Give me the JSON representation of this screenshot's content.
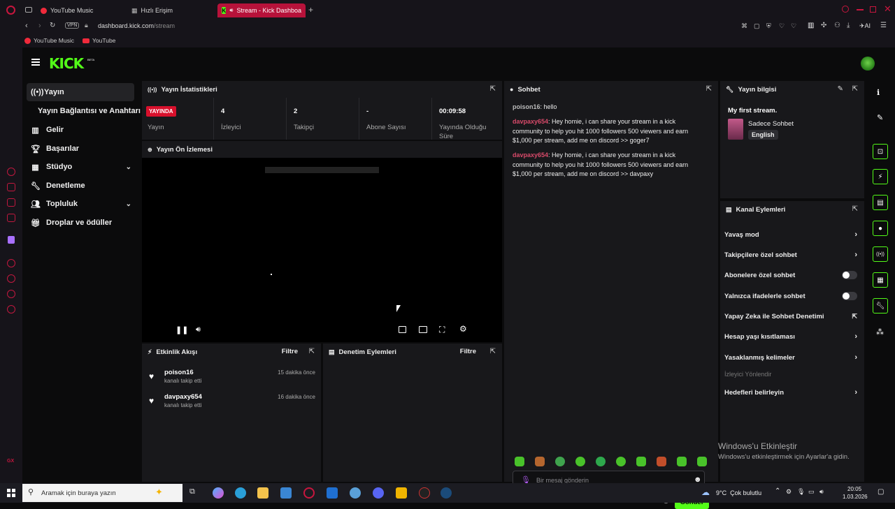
{
  "browser": {
    "tabs": [
      {
        "label": "YouTube Music"
      },
      {
        "label": "Hızlı Erişim"
      },
      {
        "label": "Stream - Kick Dashboa"
      }
    ],
    "url_host": "dashboard.kick.com",
    "url_path": "/stream",
    "vpn": "VPN",
    "bookmarks": [
      "YouTube Music",
      "YouTube"
    ],
    "ai_label": "AI"
  },
  "brand": {
    "logo": "KICK",
    "beta": "BETA",
    "accent": "#53fc18"
  },
  "sidebar": {
    "items": [
      {
        "label": "Yayın",
        "icon": "broadcast-icon"
      },
      {
        "label": "Yayın Bağlantısı ve Anahtarı",
        "icon": ""
      },
      {
        "label": "Gelir",
        "icon": "chart-icon"
      },
      {
        "label": "Başarılar",
        "icon": "trophy-icon"
      },
      {
        "label": "Stüdyo",
        "icon": "studio-icon"
      },
      {
        "label": "Denetleme",
        "icon": "wrench-icon"
      },
      {
        "label": "Topluluk",
        "icon": "people-icon"
      },
      {
        "label": "Droplar ve ödüller",
        "icon": "gift-icon"
      }
    ]
  },
  "stats": {
    "title": "Yayın İstatistikleri",
    "live_badge": "YAYINDA",
    "live_label": "Yayın",
    "viewers_value": "4",
    "viewers_label": "İzleyici",
    "followers_value": "2",
    "followers_label": "Takipçi",
    "subs_value": "-",
    "subs_label": "Abone Sayısı",
    "uptime_value": "00:09:58",
    "uptime_label_1": "Yayında Olduğu",
    "uptime_label_2": "Süre"
  },
  "preview": {
    "title": "Yayın Ön İzlemesi"
  },
  "activity": {
    "title": "Etkinlik Akışı",
    "filter": "Filtre",
    "items": [
      {
        "name": "poison16",
        "sub": "kanalı takip etti",
        "time": "15 dakika önce"
      },
      {
        "name": "davpaxy654",
        "sub": "kanalı takip etti",
        "time": "16 dakika önce"
      }
    ]
  },
  "moderation": {
    "title": "Denetim Eylemleri",
    "filter": "Filtre"
  },
  "chat": {
    "title": "Sohbet",
    "messages": [
      {
        "user": "poison16",
        "text": ": hello"
      },
      {
        "user": "davpaxy654",
        "text": ": Hey homie, i can share your stream in a kick community to help you hit 1000 followers 500 viewers and earn $1,000 per stream, add me on discord >> goger7"
      },
      {
        "user": "davpaxy654",
        "text": ": Hey homie, i can share your stream in a kick community to help you hit 1000 followers 500 viewers and earn $1,000 per stream, add me on discord >> davpaxy"
      }
    ],
    "placeholder": "Bir mesaj gönderin",
    "send": "Gönder"
  },
  "stream_info": {
    "title": "Yayın bilgisi",
    "stream_title": "My first stream.",
    "category": "Sadece Sohbet",
    "language": "English"
  },
  "channel_actions": {
    "title": "Kanal Eylemleri",
    "rows": [
      {
        "label": "Yavaş mod",
        "control": "chevron"
      },
      {
        "label": "Takipçilere özel sohbet",
        "control": "chevron"
      },
      {
        "label": "Abonelere özel sohbet",
        "control": "toggle",
        "on": false
      },
      {
        "label": "Yalnızca ifadelerle sohbet",
        "control": "toggle",
        "on": false
      },
      {
        "label": "Yapay Zeka ile Sohbet Denetimi",
        "control": "external"
      },
      {
        "label": "Hesap yaşı kısıtlaması",
        "control": "chevron"
      },
      {
        "label": "Yasaklanmış kelimeler",
        "control": "chevron"
      }
    ],
    "section_label": "İzleyici Yönlendir",
    "goals": "Hedefleri belirleyin"
  },
  "watermark": {
    "line1": "Windows'u Etkinleştir",
    "line2": "Windows'u etkinleştirmek için Ayarlar'a gidin."
  },
  "taskbar": {
    "search_placeholder": "Aramak için buraya yazın",
    "weather": "9°C  Çok bulutlu",
    "time": "20:05",
    "date": "1.03.2026"
  }
}
